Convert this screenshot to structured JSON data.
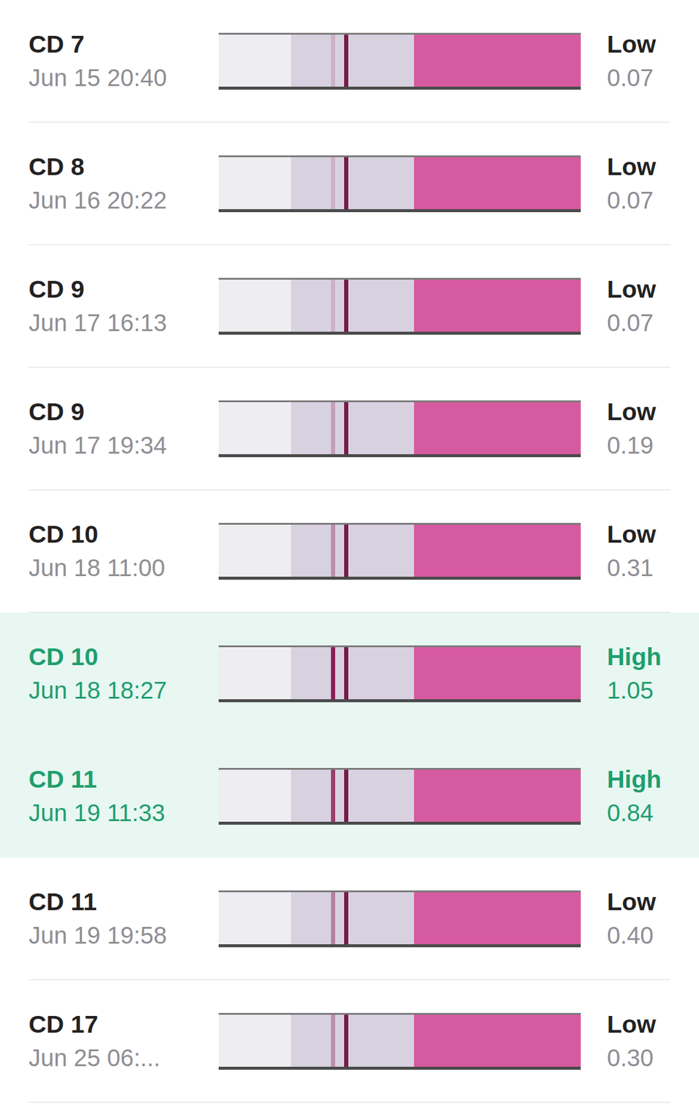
{
  "rows": [
    {
      "day": "CD 7",
      "time": "Jun 15 20:40",
      "status": "Low",
      "value": "0.07",
      "selected": false
    },
    {
      "day": "CD 8",
      "time": "Jun 16 20:22",
      "status": "Low",
      "value": "0.07",
      "selected": false
    },
    {
      "day": "CD 9",
      "time": "Jun 17 16:13",
      "status": "Low",
      "value": "0.07",
      "selected": false
    },
    {
      "day": "CD 9",
      "time": "Jun 17 19:34",
      "status": "Low",
      "value": "0.19",
      "selected": false
    },
    {
      "day": "CD 10",
      "time": "Jun 18 11:00",
      "status": "Low",
      "value": "0.31",
      "selected": false
    },
    {
      "day": "CD 10",
      "time": "Jun 18 18:27",
      "status": "High",
      "value": "1.05",
      "selected": true
    },
    {
      "day": "CD 11",
      "time": "Jun 19 11:33",
      "status": "High",
      "value": "0.84",
      "selected": true
    },
    {
      "day": "CD 11",
      "time": "Jun 19 19:58",
      "status": "Low",
      "value": "0.40",
      "selected": false
    },
    {
      "day": "CD 17",
      "time": "Jun 25 06:...",
      "status": "Low",
      "value": "0.30",
      "selected": false
    }
  ]
}
